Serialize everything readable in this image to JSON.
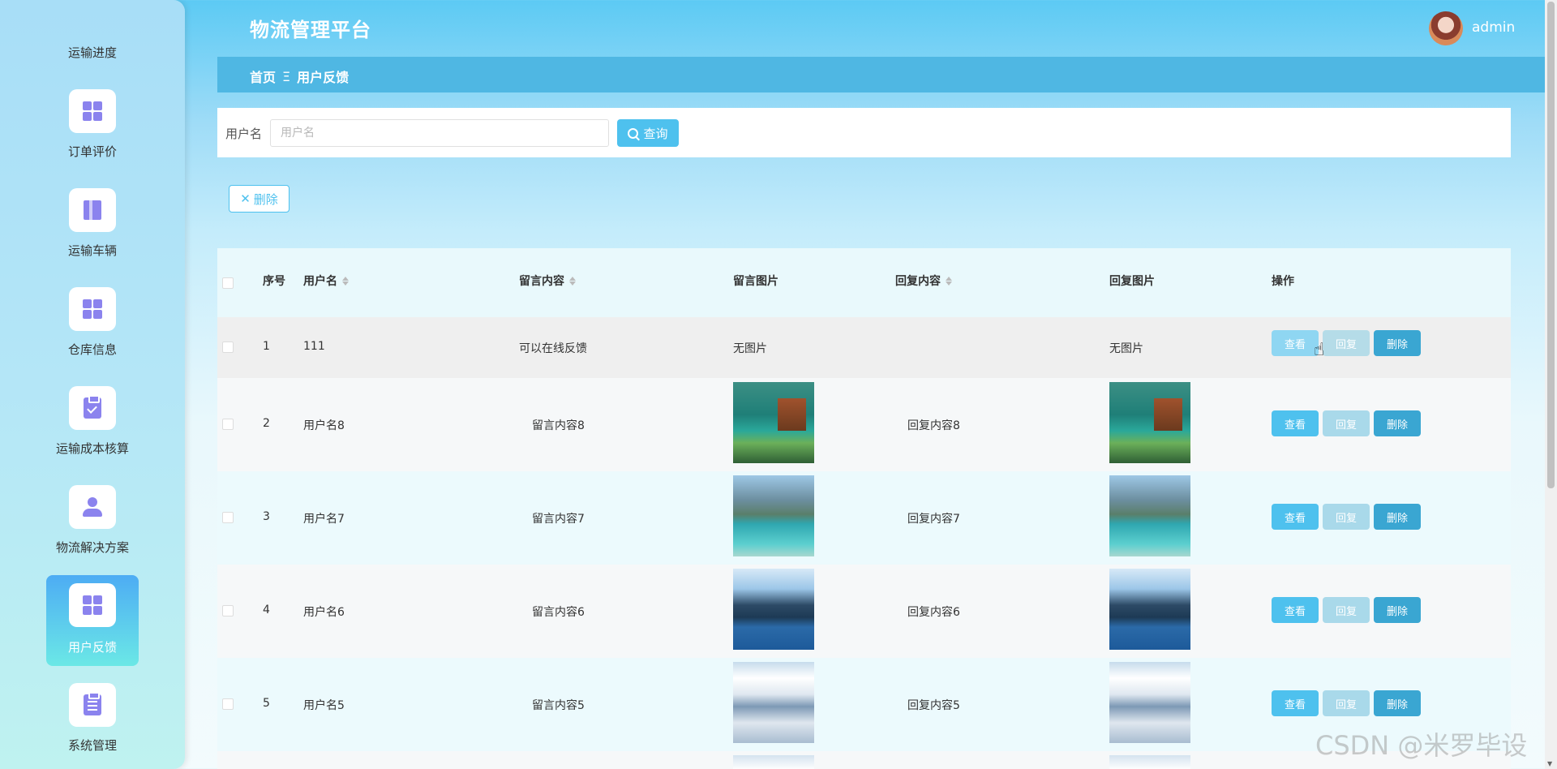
{
  "header": {
    "title": "物流管理平台",
    "username": "admin"
  },
  "sidebar": {
    "items": [
      {
        "label": "运输进度",
        "icon": "none"
      },
      {
        "label": "订单评价",
        "icon": "grid-icon"
      },
      {
        "label": "运输车辆",
        "icon": "book-icon"
      },
      {
        "label": "仓库信息",
        "icon": "grid-icon"
      },
      {
        "label": "运输成本核算",
        "icon": "clipboard-check-icon"
      },
      {
        "label": "物流解决方案",
        "icon": "user-icon"
      },
      {
        "label": "用户反馈",
        "icon": "grid-icon",
        "active": true
      },
      {
        "label": "系统管理",
        "icon": "clipboard-list-icon"
      }
    ]
  },
  "breadcrumb": {
    "home": "首页",
    "separator": "Ξ",
    "current": "用户反馈"
  },
  "search": {
    "label": "用户名",
    "placeholder": "用户名",
    "value": "",
    "button": "查询"
  },
  "toolbar": {
    "delete_label": "删除"
  },
  "table": {
    "headers": {
      "index": "序号",
      "username": "用户名",
      "content": "留言内容",
      "image": "留言图片",
      "reply": "回复内容",
      "reply_image": "回复图片",
      "actions": "操作"
    },
    "rows": [
      {
        "index": "1",
        "username": "111",
        "content": "可以在线反馈",
        "image": "无图片",
        "reply": "",
        "reply_image": "无图片"
      },
      {
        "index": "2",
        "username": "用户名8",
        "content": "留言内容8",
        "image": "lake-pagoda-photo",
        "reply": "回复内容8",
        "reply_image": "lake-pagoda-photo"
      },
      {
        "index": "3",
        "username": "用户名7",
        "content": "留言内容7",
        "image": "mountain-lake-photo",
        "reply": "回复内容7",
        "reply_image": "mountain-lake-photo"
      },
      {
        "index": "4",
        "username": "用户名6",
        "content": "留言内容6",
        "image": "mountain-sea-photo",
        "reply": "回复内容6",
        "reply_image": "mountain-sea-photo"
      },
      {
        "index": "5",
        "username": "用户名5",
        "content": "留言内容5",
        "image": "snow-mountain-photo",
        "reply": "回复内容5",
        "reply_image": "snow-mountain-photo"
      }
    ],
    "actions": {
      "view": "查看",
      "reply": "回复",
      "delete": "删除"
    }
  },
  "watermark": "CSDN @米罗毕设",
  "colors": {
    "primary": "#4ec1ee",
    "breadcrumb_bg": "#4fb7e3",
    "delete_btn": "#3aa6d2",
    "icon_purple": "#8b83ee"
  }
}
